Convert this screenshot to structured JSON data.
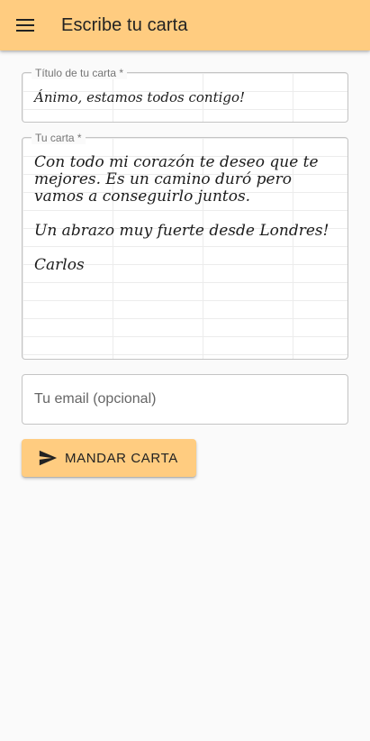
{
  "appbar": {
    "title": "Escribe tu carta",
    "menu_icon": "menu-icon",
    "color": "#ffcc80"
  },
  "form": {
    "title_field": {
      "label": "Título de tu carta *",
      "value": "Ánimo, estamos todos contigo!"
    },
    "letter_field": {
      "label": "Tu carta *",
      "paragraphs": [
        "Con todo mi corazón te deseo que te mejores. Es un camino duró pero vamos a conseguirlo juntos.",
        "Un abrazo muy fuerte desde Londres!",
        "Carlos"
      ]
    },
    "email_field": {
      "placeholder": "Tu email (opcional)",
      "value": ""
    },
    "send_button": {
      "label": "MANDAR CARTA",
      "icon": "send-icon"
    }
  }
}
